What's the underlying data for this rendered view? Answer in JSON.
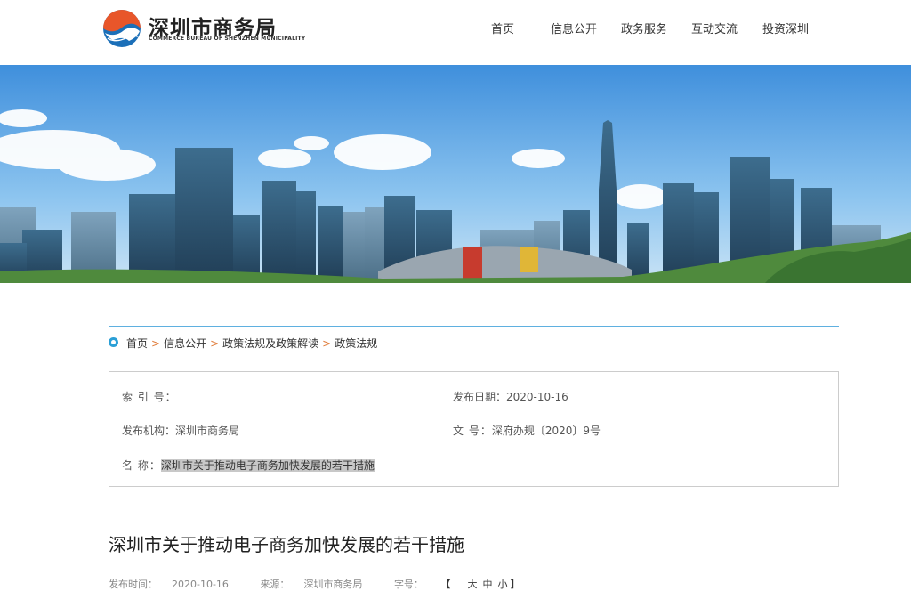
{
  "site": {
    "name_cn": "深圳市商务局",
    "name_en": "COMMERCE BUREAU OF SHENZHEN MUNICIPALITY"
  },
  "nav": [
    "首页",
    "信息公开",
    "政务服务",
    "互动交流",
    "投资深圳"
  ],
  "breadcrumb": {
    "items": [
      "首页",
      "信息公开",
      "政策法规及政策解读",
      "政策法规"
    ],
    "separator": ">"
  },
  "info": {
    "index_label": "索 引 号：",
    "index_value": "",
    "date_label": "发布日期：",
    "date_value": "2020-10-16",
    "org_label": "发布机构：",
    "org_value": "深圳市商务局",
    "docno_label": "文 号：",
    "docno_value": "深府办规〔2020〕9号",
    "name_label": "名 称：",
    "name_value": "深圳市关于推动电子商务加快发展的若干措施"
  },
  "article": {
    "title": "深圳市关于推动电子商务加快发展的若干措施",
    "time_label": "发布时间：",
    "time_value": "2020-10-16",
    "source_label": "来源：",
    "source_value": "深圳市商务局",
    "font_label": "字号：",
    "font_sizes": [
      "大",
      "中",
      "小"
    ],
    "bracket_open": "【",
    "bracket_close": "】"
  },
  "colors": {
    "accent_blue": "#2a9fd6",
    "logo_orange": "#e8562a",
    "logo_blue": "#1b6fb8",
    "breadcrumb_sep": "#e07b39"
  },
  "icons": {
    "breadcrumb": "location-dot-icon",
    "logo": "swirl-logo-icon"
  }
}
